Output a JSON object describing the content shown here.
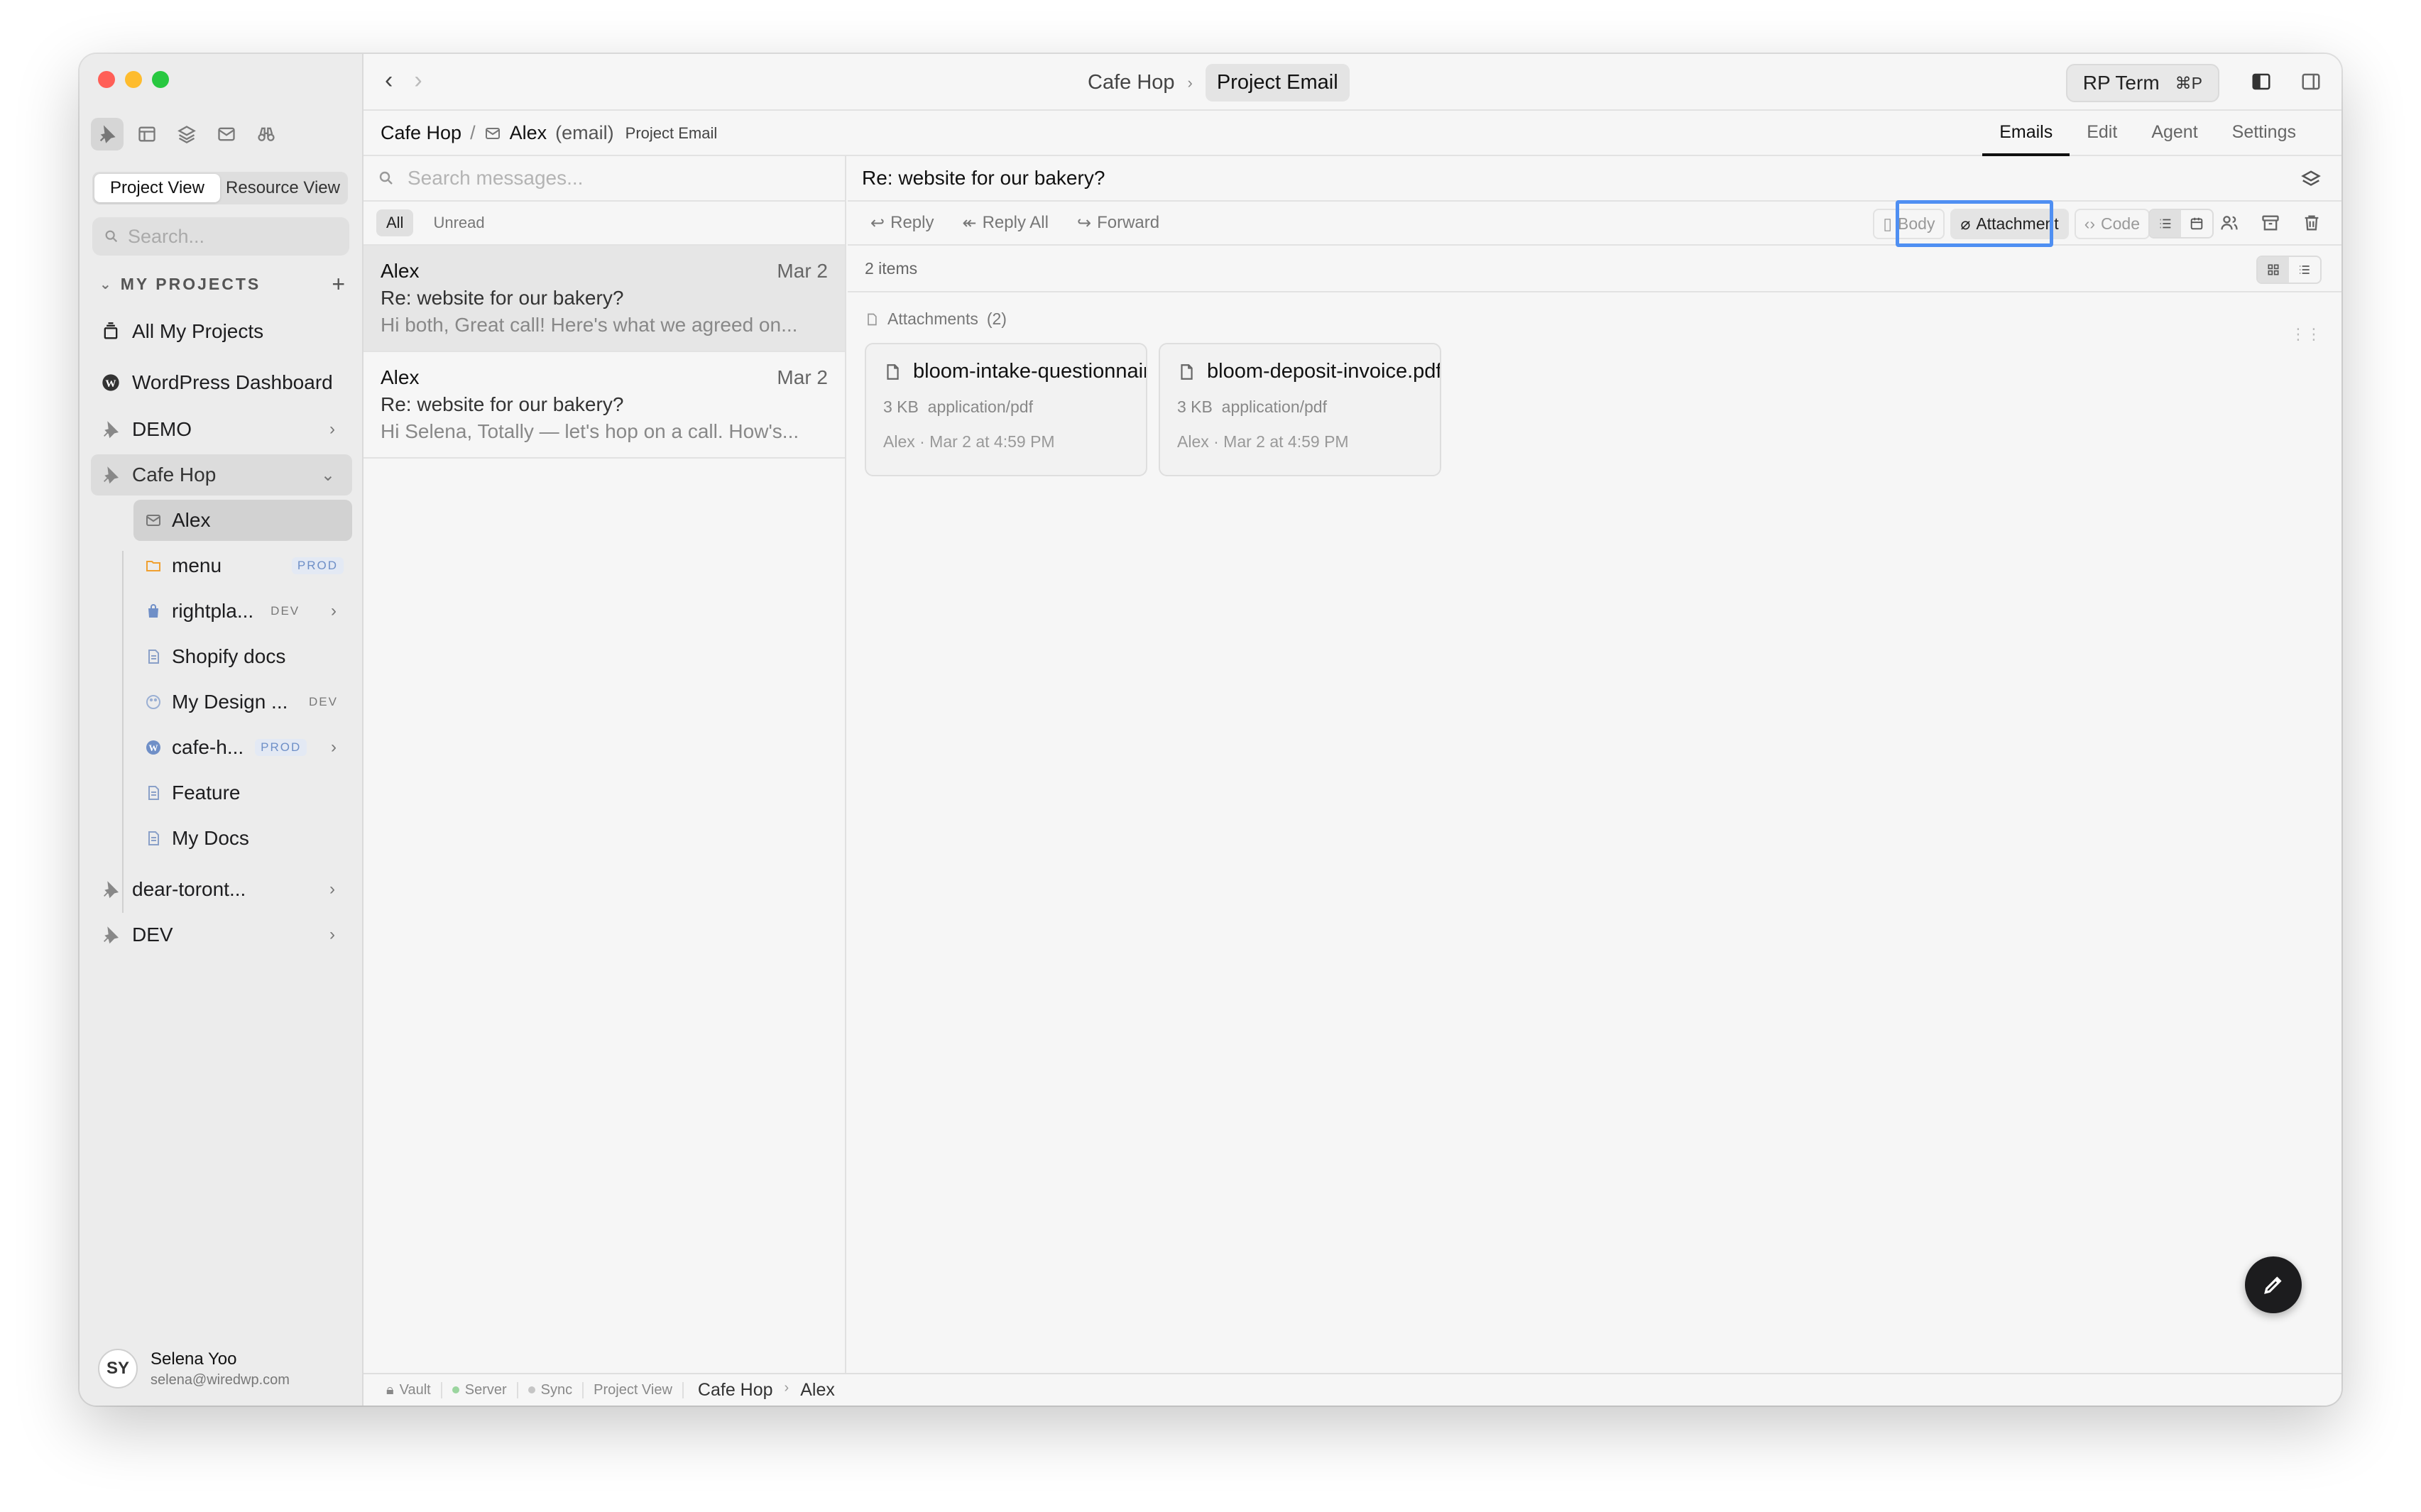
{
  "window": {
    "center_crumb": [
      "Cafe Hop",
      "Project Email"
    ],
    "rp_term": "RP Term",
    "rp_term_shortcut": "⌘P"
  },
  "sidebar": {
    "view_tabs": [
      "Project View",
      "Resource View"
    ],
    "search_placeholder": "Search...",
    "section_title": "MY PROJECTS",
    "items": {
      "all_projects": "All My Projects",
      "wordpress": "WordPress Dashboard",
      "demo": "DEMO",
      "cafe_hop": "Cafe Hop",
      "dear_toront": "dear-toront...",
      "dev": "DEV"
    },
    "children": [
      {
        "label": "Alex",
        "badge": ""
      },
      {
        "label": "menu",
        "badge": "PROD"
      },
      {
        "label": "rightpla...",
        "badge": "DEV"
      },
      {
        "label": "Shopify docs",
        "badge": ""
      },
      {
        "label": "My Design ...",
        "badge": "DEV"
      },
      {
        "label": "cafe-h...",
        "badge": "PROD"
      },
      {
        "label": "Feature",
        "badge": ""
      },
      {
        "label": "My Docs",
        "badge": ""
      }
    ],
    "user": {
      "initials": "SY",
      "name": "Selena Yoo",
      "email": "selena@wiredwp.com"
    }
  },
  "subbar": {
    "crumb_project": "Cafe Hop",
    "crumb_name": "Alex",
    "crumb_kind": "(email)",
    "crumb_suffix": "Project Email",
    "tabs": [
      "Emails",
      "Edit",
      "Agent",
      "Settings"
    ]
  },
  "messages": {
    "search_placeholder": "Search messages...",
    "filters": [
      "All",
      "Unread"
    ],
    "list": [
      {
        "from": "Alex",
        "date": "Mar 2",
        "subject": "Re: website for our bakery?",
        "preview": "Hi both, Great call! Here's what we agreed on..."
      },
      {
        "from": "Alex",
        "date": "Mar 2",
        "subject": "Re: website for our bakery?",
        "preview": "Hi Selena, Totally — let's hop on a call. How's..."
      }
    ]
  },
  "reader": {
    "title": "Re: website for our bakery?",
    "actions": [
      "Reply",
      "Reply All",
      "Forward"
    ],
    "segments": [
      "Body",
      "Attachment",
      "Code"
    ],
    "count": "2 items",
    "attachments_label": "Attachments",
    "attachments_count": "(2)",
    "files": [
      {
        "name": "bloom-intake-questionnaire.pdf",
        "size": "3 KB",
        "type": "application/pdf",
        "meta": "Alex · Mar 2 at 4:59 PM"
      },
      {
        "name": "bloom-deposit-invoice.pdf",
        "size": "3 KB",
        "type": "application/pdf",
        "meta": "Alex · Mar 2 at 4:59 PM"
      }
    ]
  },
  "statusbar": {
    "items": [
      "Vault",
      "Server",
      "Sync",
      "Project View"
    ],
    "crumb": [
      "Cafe Hop",
      "Alex"
    ]
  },
  "colors": {
    "accent_highlight": "#4f8ff2",
    "prod_badge": "#6e8fc7",
    "window_bg": "#f6f6f6"
  }
}
